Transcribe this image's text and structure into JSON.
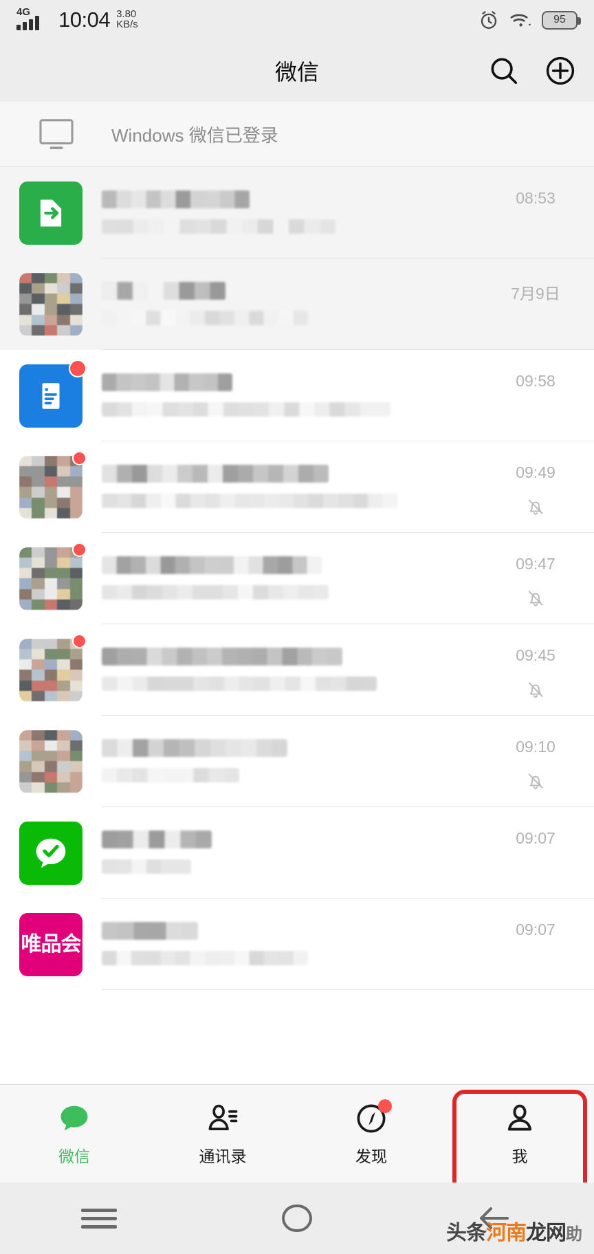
{
  "status_bar": {
    "network_type": "4G",
    "time": "10:04",
    "speed_value": "3.80",
    "speed_unit": "KB/s",
    "battery_level": "95",
    "icons": [
      "alarm-icon",
      "wifi-icon",
      "battery-icon"
    ]
  },
  "header": {
    "title": "微信",
    "search_icon": "search-icon",
    "add_icon": "plus-circle-icon"
  },
  "windows_banner": {
    "icon": "desktop-monitor-icon",
    "text": "Windows 微信已登录"
  },
  "chats": [
    {
      "avatar_type": "file-transfer",
      "name_redacted": "",
      "preview_redacted": "",
      "time": "08:53",
      "muted": false,
      "unread": false,
      "pinned": true
    },
    {
      "avatar_type": "photo-mosaic",
      "name_redacted": "",
      "preview_redacted": "",
      "time": "7月9日",
      "muted": false,
      "unread": false,
      "pinned": true
    },
    {
      "avatar_type": "document",
      "name_redacted": "",
      "preview_redacted": "",
      "time": "09:58",
      "muted": false,
      "unread": true,
      "pinned": false
    },
    {
      "avatar_type": "photo-mosaic",
      "name_redacted": "",
      "preview_redacted": "",
      "time": "09:49",
      "muted": true,
      "unread": true,
      "pinned": false
    },
    {
      "avatar_type": "photo-mosaic",
      "name_redacted": "",
      "preview_redacted": "",
      "time": "09:47",
      "muted": true,
      "unread": true,
      "pinned": false
    },
    {
      "avatar_type": "photo-mosaic",
      "name_redacted": "",
      "preview_redacted": "",
      "time": "09:45",
      "muted": true,
      "unread": true,
      "pinned": false
    },
    {
      "avatar_type": "photo-mosaic",
      "name_redacted": "",
      "preview_redacted": "",
      "time": "09:10",
      "muted": true,
      "unread": false,
      "pinned": false
    },
    {
      "avatar_type": "green-check-chat",
      "name_redacted": "",
      "preview_redacted": "",
      "time": "09:07",
      "muted": false,
      "unread": false,
      "pinned": false
    },
    {
      "avatar_type": "vipshop",
      "avatar_text": "唯品会",
      "name_redacted": "",
      "preview_redacted": "",
      "time": "09:07",
      "muted": false,
      "unread": false,
      "pinned": false
    }
  ],
  "tabbar": {
    "active_color": "#3ebd5d",
    "highlight_color": "#dc2828",
    "items": [
      {
        "label": "微信",
        "icon": "chat-bubble-icon",
        "active": true,
        "badge": false,
        "highlighted": false
      },
      {
        "label": "通讯录",
        "icon": "contacts-icon",
        "active": false,
        "badge": false,
        "highlighted": false
      },
      {
        "label": "发现",
        "icon": "compass-icon",
        "active": false,
        "badge": true,
        "highlighted": false
      },
      {
        "label": "我",
        "icon": "person-icon",
        "active": false,
        "badge": false,
        "highlighted": true
      }
    ]
  },
  "navbar": {
    "menu_icon": "hamburger-menu-icon",
    "home_icon": "home-circle-icon",
    "back_icon": "back-arrow-icon"
  },
  "watermark": {
    "part1": "头条",
    "part2": "河南",
    "part3": "龙网",
    "part4": "助",
    "accent_color": "#e8720c"
  }
}
